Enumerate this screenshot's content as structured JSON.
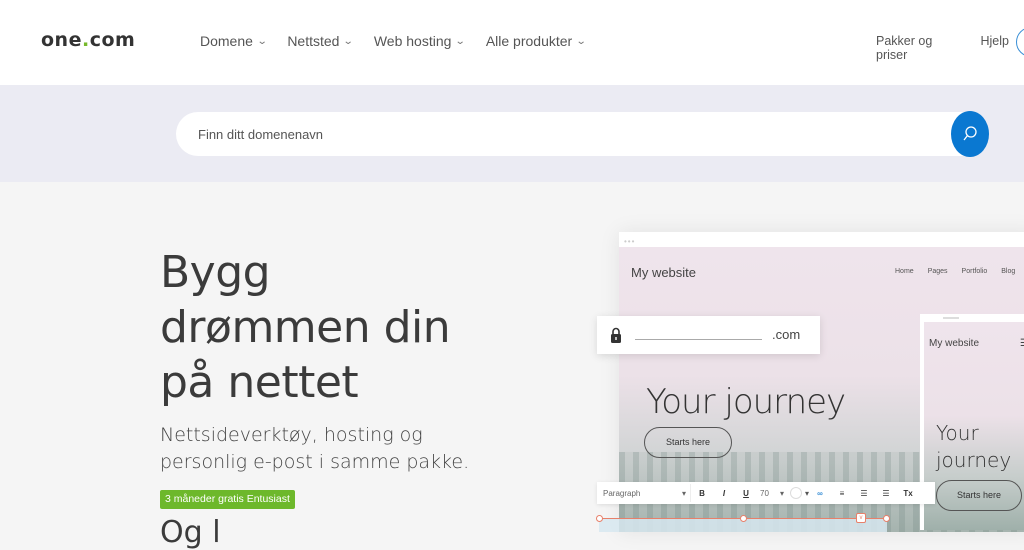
{
  "header": {
    "logo": {
      "prefix": "one",
      "dot": ".",
      "suffix": "com"
    },
    "nav": [
      {
        "label": "Domene",
        "icon": "chevron-down-icon"
      },
      {
        "label": "Nettsted",
        "icon": "chevron-down-icon"
      },
      {
        "label": "Web hosting",
        "icon": "chevron-down-icon"
      },
      {
        "label": "Alle produkter",
        "icon": "chevron-down-icon"
      }
    ],
    "right_links": [
      "Pakker og priser",
      "Hjelp"
    ],
    "chevron": "⌄"
  },
  "search": {
    "placeholder": "Finn ditt domenenavn",
    "value": "",
    "button_icon": "search-icon"
  },
  "hero": {
    "title_lines": [
      "Bygg",
      "drømmen din",
      "på nettet"
    ],
    "subtitle_lines": [
      "Nettsideverktøy, hosting og",
      "personlig e-post i samme pakke."
    ],
    "promo_badge": "3 måneder gratis Entusiast",
    "more_text": "Og l"
  },
  "mockup": {
    "dots": "•••",
    "site_name": "My website",
    "nav": [
      "Home",
      "Pages",
      "Portfolio",
      "Blog"
    ],
    "headline": "Your journey",
    "cta": "Starts here",
    "domain_tld": ".com",
    "phone": {
      "site_name": "My website",
      "menu_icon": "☰",
      "headline_lines": [
        "Your",
        "journey"
      ],
      "cta": "Starts here"
    },
    "toolbar": {
      "style": "Paragraph",
      "bold": "B",
      "italic": "I",
      "underline": "U",
      "size": "70",
      "dropdown": "▾",
      "link": "∞",
      "align": "≡",
      "ordered_list": "☰",
      "bullet_list": "☰",
      "clear": "Tx"
    }
  },
  "colors": {
    "brand_green": "#76b82a",
    "search_blue": "#0a78d1",
    "badge_green": "#6db82b",
    "selection": "#e8806a"
  }
}
